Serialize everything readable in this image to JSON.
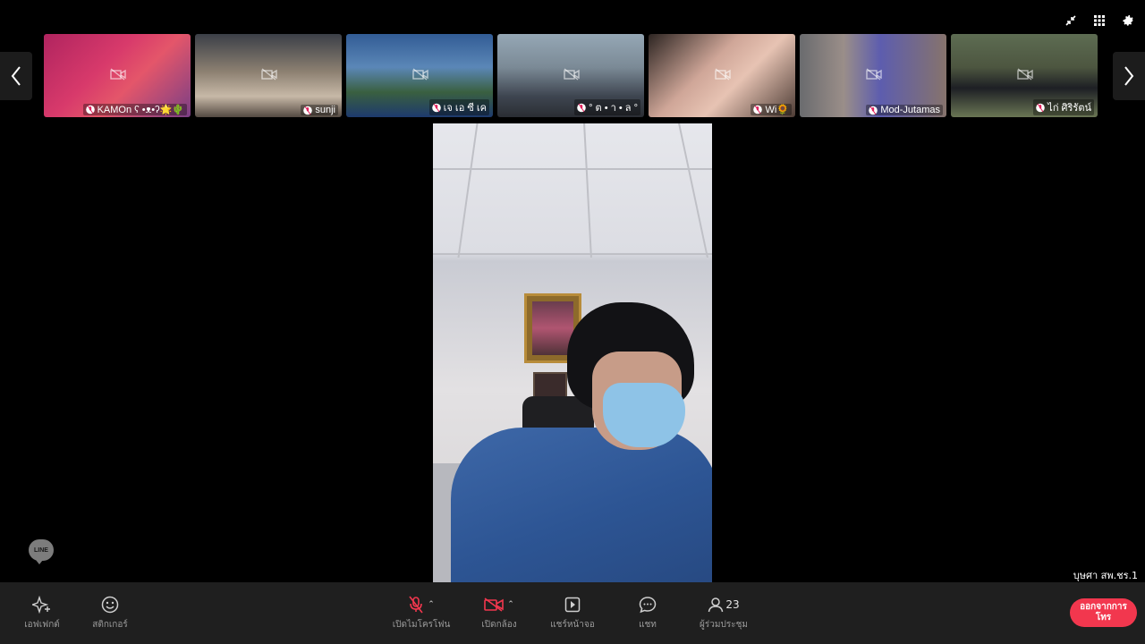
{
  "participants": [
    {
      "name": "KAMOn ʕ •ᴥ•ʔ🌟🌵"
    },
    {
      "name": "sunji"
    },
    {
      "name": "เจ เอ ซี เค"
    },
    {
      "name": "° ต • า • ล °"
    },
    {
      "name": "Wi🌻"
    },
    {
      "name": "Mod-Jutamas"
    },
    {
      "name": "ไก่ ศิริรัตน์"
    }
  ],
  "speaker": {
    "name": "บุษศา สพ.ชร.1"
  },
  "watermark": "LINE",
  "toolbar": {
    "effects_label": "เอฟเฟกต์",
    "sticker_label": "สติกเกอร์",
    "mic_label": "เปิดไมโครโฟน",
    "camera_label": "เปิดกล้อง",
    "share_label": "แชร์หน้าจอ",
    "chat_label": "แชท",
    "participants_label": "ผู้ร่วมประชุม",
    "participants_count": "23",
    "leave_label": "ออกจากการโทร"
  },
  "colors": {
    "background": "#000000",
    "toolbar": "#1f1f1f",
    "leave": "#f2374e"
  },
  "icons": [
    "minimize-icon",
    "grid-icon",
    "gear-icon",
    "chevron-left-icon",
    "chevron-right-icon",
    "camera-off-icon",
    "mic-muted-icon",
    "sparkle-icon",
    "smiley-icon",
    "share-screen-icon",
    "chat-icon",
    "person-icon"
  ]
}
